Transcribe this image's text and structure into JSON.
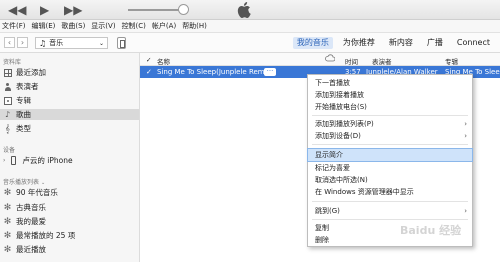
{
  "menubar": [
    "文件(F)",
    "编辑(E)",
    "歌曲(S)",
    "显示(V)",
    "控制(C)",
    "帐户(A)",
    "帮助(H)"
  ],
  "navbar": {
    "library_selector": "音乐",
    "tabs": [
      "我的音乐",
      "为你推荐",
      "新内容",
      "广播",
      "Connect"
    ],
    "active_tab": "我的音乐"
  },
  "sidebar": {
    "library_header": "资料库",
    "library_items": [
      "最近添加",
      "表演者",
      "专辑",
      "歌曲",
      "类型"
    ],
    "selected": "歌曲",
    "devices_header": "设备",
    "device": "卢云的 iPhone",
    "playlists_header": "音乐播放列表",
    "playlists": [
      "90 年代音乐",
      "古典音乐",
      "我的最爱",
      "最常播放的 25 项",
      "最近播放"
    ]
  },
  "table": {
    "columns": {
      "check": "✓",
      "name": "名称",
      "time": "时间",
      "artist": "表演者",
      "album": "专辑"
    },
    "row": {
      "check": "✓",
      "name": "Sing Me To Sleep(Junplele Remix)",
      "more": "···",
      "time": "3:57",
      "artist": "Junplele/Alan Walker",
      "album": "Sing Me To Sleep"
    }
  },
  "context_menu": {
    "items": [
      {
        "label": "下一首播放"
      },
      {
        "label": "添加到接着播放"
      },
      {
        "label": "开始播放电台(S)"
      },
      {
        "label": "添加到播放列表(P)",
        "submenu": "›"
      },
      {
        "label": "添加到设备(D)",
        "submenu": "›"
      },
      {
        "label": "显示简介"
      },
      {
        "label": "标记为喜爱"
      },
      {
        "label": "取消选中所选(N)"
      },
      {
        "label": "在 Windows 资源管理器中显示"
      },
      {
        "label": "跳到(G)",
        "submenu": "›"
      },
      {
        "label": "复制"
      },
      {
        "label": "删除"
      }
    ],
    "highlighted": "显示简介"
  },
  "watermark": "Baidu 经验"
}
